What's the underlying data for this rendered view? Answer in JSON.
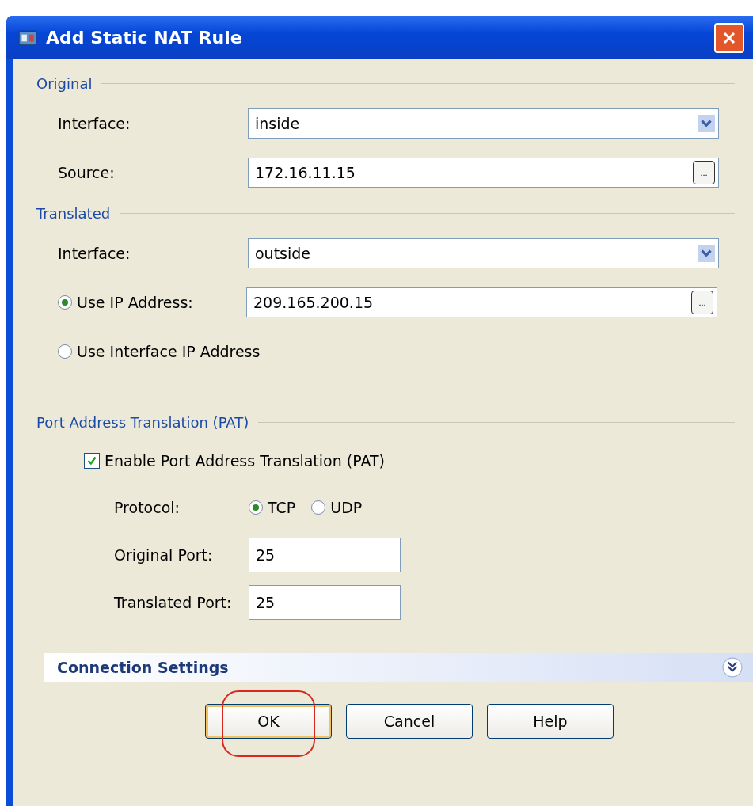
{
  "window": {
    "title": "Add Static NAT Rule"
  },
  "original": {
    "legend": "Original",
    "interface": {
      "label": "Interface:",
      "value": "inside"
    },
    "source": {
      "label": "Source:",
      "value": "172.16.11.15",
      "browse": "..."
    }
  },
  "translated": {
    "legend": "Translated",
    "interface": {
      "label": "Interface:",
      "value": "outside"
    },
    "options": [
      {
        "label": "Use IP Address:",
        "selected": true,
        "value": "209.165.200.15",
        "browse": "..."
      },
      {
        "label": "Use Interface IP Address",
        "selected": false
      }
    ]
  },
  "pat": {
    "legend": "Port Address Translation (PAT)",
    "enable": {
      "label": "Enable Port Address Translation (PAT)",
      "checked": true
    },
    "protocol": {
      "label": "Protocol:",
      "options": [
        {
          "label": "TCP",
          "selected": true
        },
        {
          "label": "UDP",
          "selected": false
        }
      ]
    },
    "ports": [
      {
        "label": "Original Port:",
        "value": "25"
      },
      {
        "label": "Translated Port:",
        "value": "25"
      }
    ]
  },
  "connection_settings": {
    "label": "Connection Settings",
    "expanded": false
  },
  "buttons": [
    {
      "label": "OK",
      "default": true,
      "highlighted": true
    },
    {
      "label": "Cancel",
      "default": false,
      "highlighted": false
    },
    {
      "label": "Help",
      "default": false,
      "highlighted": false
    }
  ]
}
